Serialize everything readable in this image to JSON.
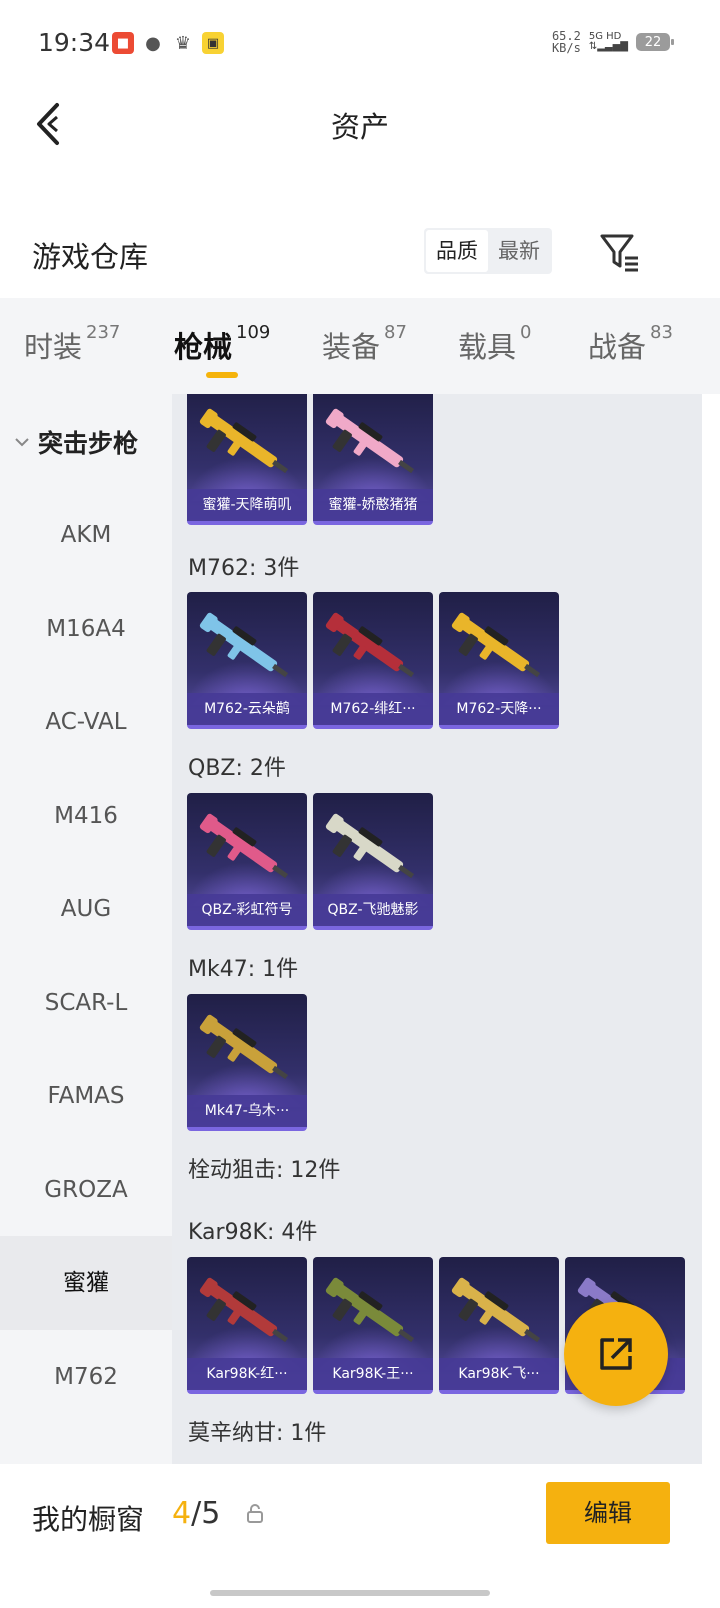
{
  "status": {
    "time": "19:34",
    "netspeed_value": "65.2",
    "netspeed_unit": "KB/s",
    "signal": "5G HD",
    "battery": "22"
  },
  "nav": {
    "title": "资产"
  },
  "section": {
    "title": "游戏仓库",
    "sort_quality": "品质",
    "sort_latest": "最新"
  },
  "tabs": [
    {
      "label": "时装",
      "count": "237"
    },
    {
      "label": "枪械",
      "count": "109"
    },
    {
      "label": "装备",
      "count": "87"
    },
    {
      "label": "载具",
      "count": "0"
    },
    {
      "label": "战备",
      "count": "83"
    }
  ],
  "side": {
    "group": "突击步枪",
    "items": [
      "AKM",
      "M16A4",
      "AC-VAL",
      "M416",
      "AUG",
      "SCAR-L",
      "FAMAS",
      "GROZA",
      "蜜獾",
      "M762"
    ],
    "active_index": 8
  },
  "content": {
    "groups": [
      {
        "label": "",
        "cards": [
          {
            "name": "蜜獾-天降萌叽",
            "color": "#e9b52a"
          },
          {
            "name": "蜜獾-娇憨猪猪",
            "color": "#f0a9c8"
          }
        ]
      },
      {
        "label": "M762: 3件",
        "cards": [
          {
            "name": "M762-云朵鹋",
            "color": "#7fc4e8"
          },
          {
            "name": "M762-绯红···",
            "color": "#b52f3a"
          },
          {
            "name": "M762-天降···",
            "color": "#e9b52a"
          }
        ]
      },
      {
        "label": "QBZ: 2件",
        "cards": [
          {
            "name": "QBZ-彩虹符号",
            "color": "#e05a8a"
          },
          {
            "name": "QBZ-飞驰魅影",
            "color": "#d8d8c8"
          }
        ]
      },
      {
        "label": "Mk47: 1件",
        "cards": [
          {
            "name": "Mk47-乌木···",
            "color": "#c9a13a"
          }
        ]
      },
      {
        "label": "栓动狙击: 12件",
        "cards": []
      },
      {
        "label": "Kar98K: 4件",
        "cards": [
          {
            "name": "Kar98K-红···",
            "color": "#b23a3a"
          },
          {
            "name": "Kar98K-王···",
            "color": "#7a8a3a"
          },
          {
            "name": "Kar98K-飞···",
            "color": "#d9b24a"
          },
          {
            "name": "",
            "color": "#8a7ac8"
          }
        ]
      },
      {
        "label": "莫辛纳甘: 1件",
        "cards": []
      }
    ]
  },
  "bottom": {
    "title": "我的橱窗",
    "count_current": "4",
    "count_total": "/5",
    "edit_label": "编辑"
  },
  "colors": {
    "accent": "#f5b10f",
    "card_bg": "#2b2960",
    "card_caption": "#463a96"
  }
}
